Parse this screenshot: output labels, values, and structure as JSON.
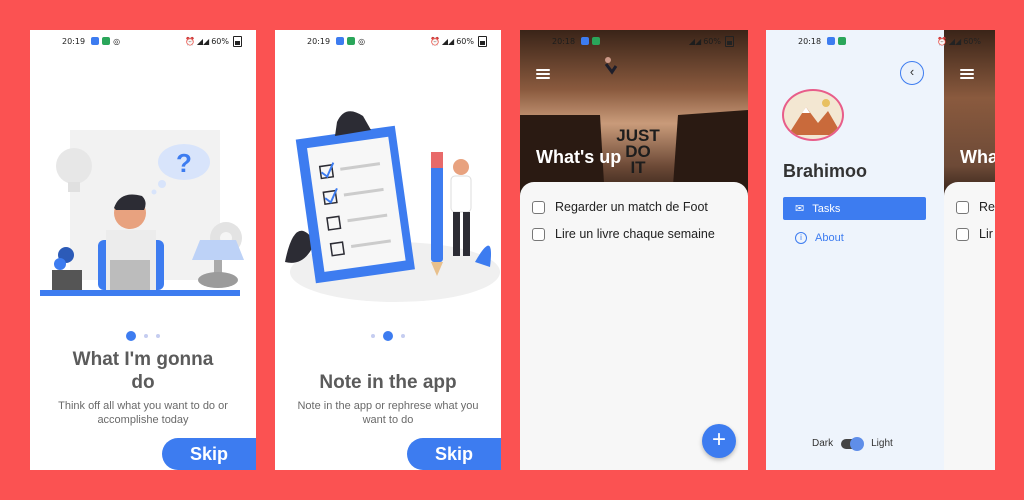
{
  "status": {
    "times": [
      "20:19",
      "20:19",
      "20:18",
      "20:18"
    ],
    "battery": "60%"
  },
  "onboarding1": {
    "title": "What I'm gonna do",
    "subtitle": "Think off all what you want to do or accomplishe today",
    "skip": "Skip",
    "page_index": 0,
    "page_count": 3,
    "icons": [
      "question-bubble-icon",
      "lightbulb-icon",
      "gear-icon",
      "plant-icon",
      "lamp-icon"
    ]
  },
  "onboarding2": {
    "title": "Note in the app",
    "subtitle": "Note in the app or rephrese what you want to do",
    "skip": "Skip",
    "page_index": 1,
    "page_count": 3,
    "icons": [
      "clipboard-icon",
      "pencil-icon",
      "checkbox-icon"
    ]
  },
  "home": {
    "header_title": "What's up",
    "hero_text": [
      "JUST",
      "DO",
      "IT"
    ],
    "tasks": [
      {
        "label": "Regarder un match de Foot",
        "done": false
      },
      {
        "label": "Lire un livre chaque semaine",
        "done": false
      }
    ],
    "fab_label": "+"
  },
  "drawer": {
    "username": "Brahimoo",
    "nav": [
      {
        "label": "Tasks",
        "icon": "inbox-icon",
        "active": true
      },
      {
        "label": "About",
        "icon": "info-icon",
        "active": false
      }
    ],
    "theme_dark": "Dark",
    "theme_light": "Light",
    "theme_is_light": true,
    "back_icon": "chevron-left-icon",
    "behind_title": "Wha",
    "behind_tasks": [
      "Re",
      "Lir"
    ]
  },
  "colors": {
    "background": "#fb5252",
    "accent": "#3d7cf0",
    "drawer_bg": "#eef4fc"
  }
}
